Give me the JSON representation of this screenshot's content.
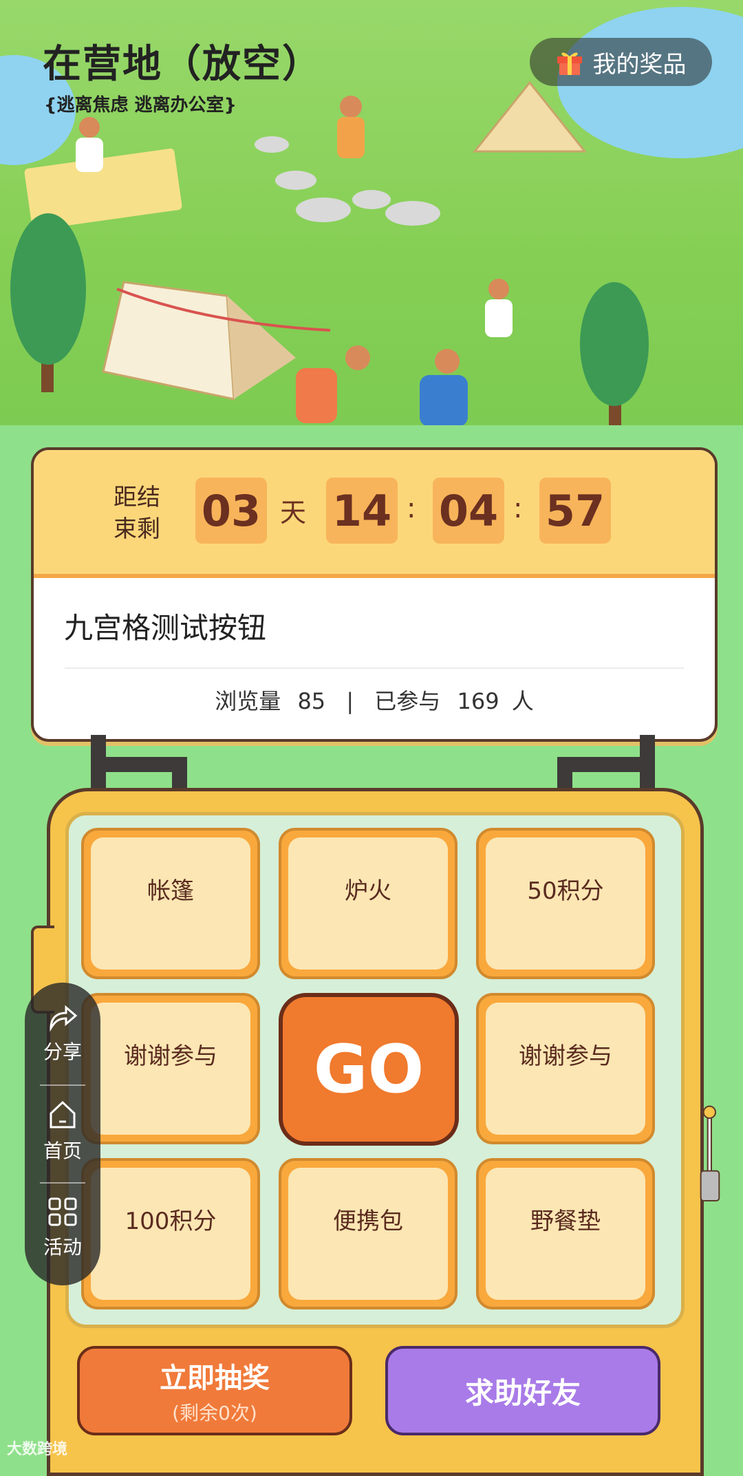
{
  "hero": {
    "title": "在营地（放空）",
    "subtitle": "{逃离焦虑 逃离办公室}",
    "prize_button": "我的奖品"
  },
  "timer": {
    "label": "距结束剩",
    "days": "03",
    "day_unit": "天",
    "hours": "14",
    "minutes": "04",
    "seconds": "57",
    "separator": ":"
  },
  "activity": {
    "title": "九宫格测试按钮",
    "views_label": "浏览量",
    "views": "85",
    "divider": "|",
    "joined_label": "已参与",
    "joined": "169",
    "joined_unit": "人"
  },
  "grid": {
    "cells": [
      "帐篷",
      "炉火",
      "50积分",
      "谢谢参与",
      "谢谢参与",
      "100积分",
      "便携包",
      "野餐垫"
    ],
    "go": "GO"
  },
  "actions": {
    "draw_label": "立即抽奖",
    "draw_remaining": "(剩余0次)",
    "help_label": "求助好友"
  },
  "float_menu": {
    "share": "分享",
    "home": "首页",
    "activity": "活动"
  },
  "watermark": "大数跨境",
  "colors": {
    "accent_orange": "#f07a2d",
    "accent_purple": "#a97be8",
    "background_green": "#8fe08a"
  }
}
